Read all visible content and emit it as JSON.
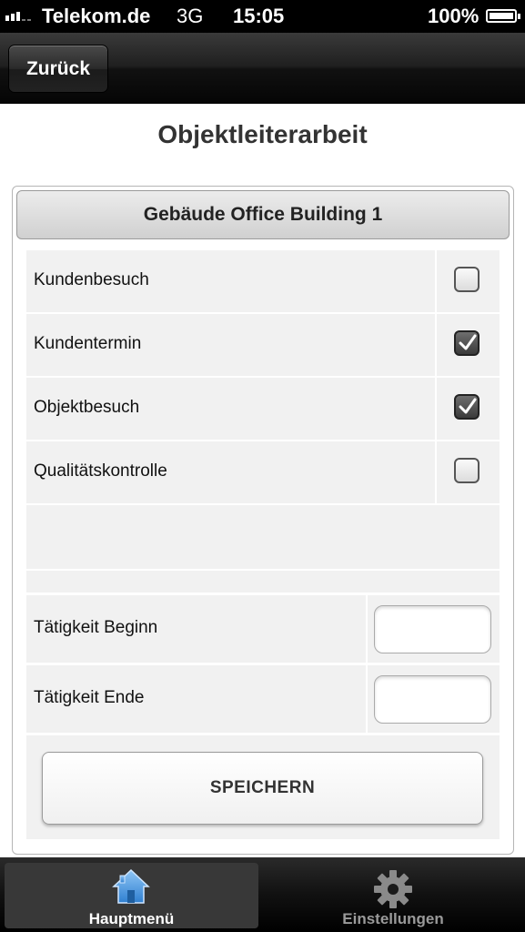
{
  "status_bar": {
    "carrier": "Telekom.de",
    "network": "3G",
    "time": "15:05",
    "battery": "100%"
  },
  "nav": {
    "back_label": "Zurück"
  },
  "page": {
    "title": "Objektleiterarbeit"
  },
  "panel": {
    "header": "Gebäude Office Building 1",
    "checklist": [
      {
        "label": "Kundenbesuch",
        "checked": false
      },
      {
        "label": "Kundentermin",
        "checked": true
      },
      {
        "label": "Objektbesuch",
        "checked": true
      },
      {
        "label": "Qualitätskontrolle",
        "checked": false
      }
    ],
    "fields": [
      {
        "label": "Tätigkeit Beginn",
        "value": ""
      },
      {
        "label": "Tätigkeit Ende",
        "value": ""
      }
    ],
    "save_label": "SPEICHERN"
  },
  "tabbar": {
    "tabs": [
      {
        "label": "Hauptmenü",
        "icon": "home-icon",
        "active": true
      },
      {
        "label": "Einstellungen",
        "icon": "gear-icon",
        "active": false
      }
    ]
  },
  "colors": {
    "active_tab_icon": "#4a90d9",
    "inactive_tab": "#9a9a9a"
  }
}
